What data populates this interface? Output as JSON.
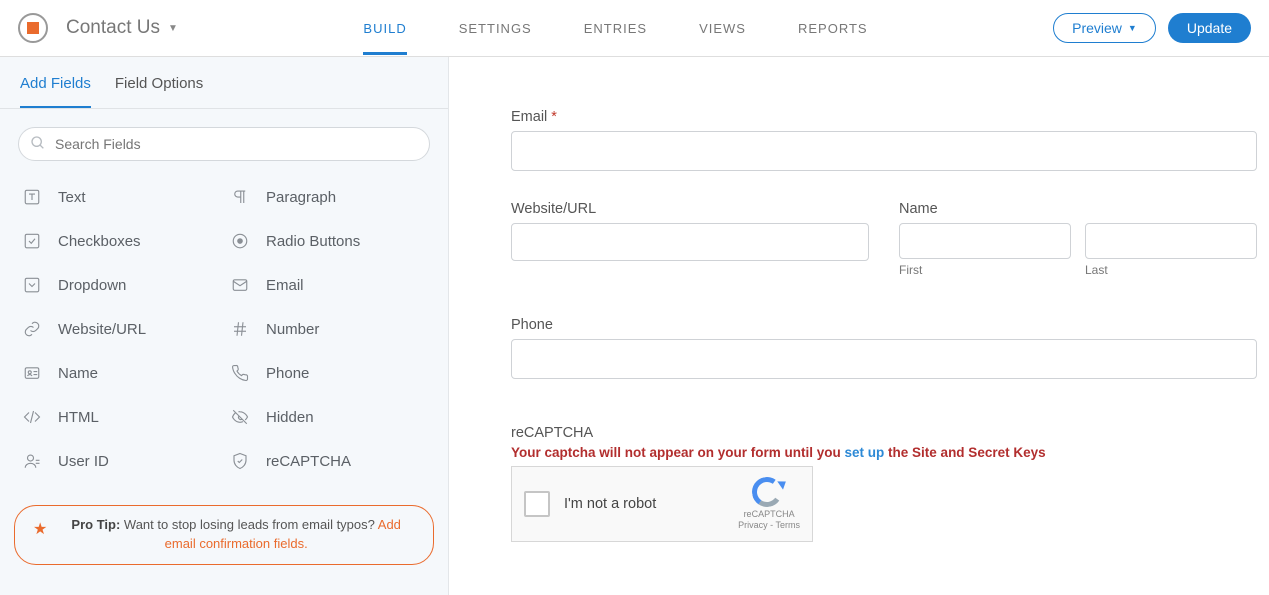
{
  "header": {
    "title": "Contact Us",
    "nav": {
      "build": "BUILD",
      "settings": "SETTINGS",
      "entries": "ENTRIES",
      "views": "VIEWS",
      "reports": "REPORTS"
    },
    "preview": "Preview",
    "update": "Update"
  },
  "sidebar": {
    "tabs": {
      "add": "Add Fields",
      "options": "Field Options"
    },
    "search_placeholder": "Search Fields",
    "fields": {
      "text": "Text",
      "paragraph": "Paragraph",
      "checkboxes": "Checkboxes",
      "radio": "Radio Buttons",
      "dropdown": "Dropdown",
      "email": "Email",
      "website": "Website/URL",
      "number": "Number",
      "name": "Name",
      "phone": "Phone",
      "html": "HTML",
      "hidden": "Hidden",
      "userid": "User ID",
      "recaptcha": "reCAPTCHA"
    },
    "protip_label": "Pro Tip:",
    "protip_text": " Want to stop losing leads from email typos? ",
    "protip_link": "Add email confirmation fields."
  },
  "form": {
    "email_label": "Email ",
    "website_label": "Website/URL",
    "name_label": "Name",
    "first": "First",
    "last": "Last",
    "phone_label": "Phone",
    "recaptcha_label": "reCAPTCHA",
    "warn_a": "Your captcha will not appear on your form until you ",
    "warn_link": "set up",
    "warn_b": " the Site and Secret Keys",
    "rc_text": "I'm not a robot",
    "rc_brand": "reCAPTCHA",
    "rc_terms": "Privacy - Terms"
  }
}
